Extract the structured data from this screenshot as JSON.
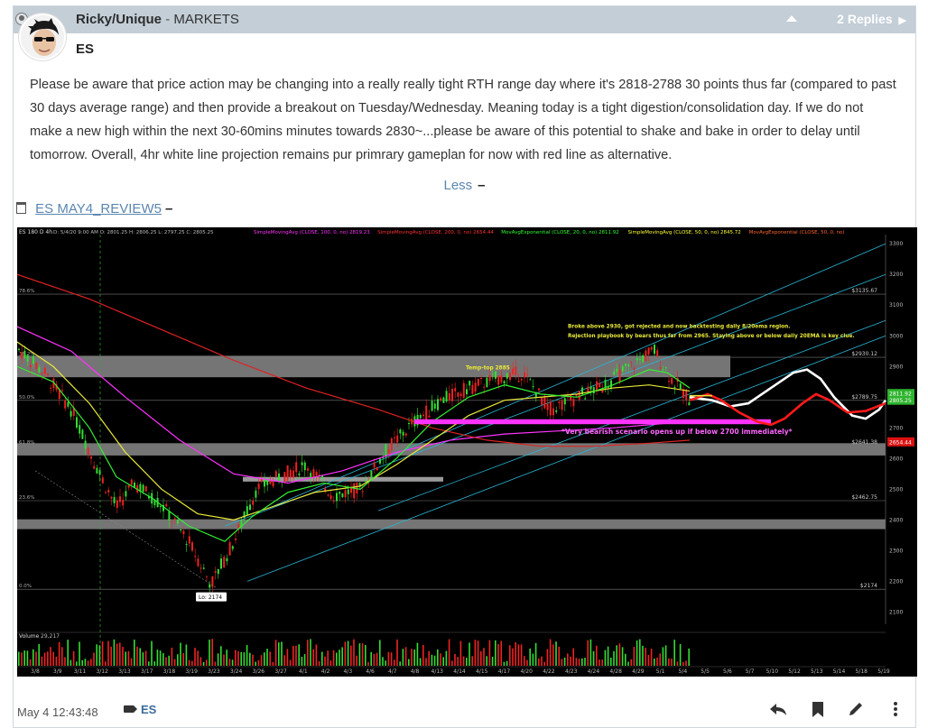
{
  "post": {
    "author": "Ricky/Unique",
    "separator": " - ",
    "category": "MARKETS",
    "replies": "2 Replies",
    "title": "ES",
    "body": "Please be aware that price action may be changing into a really really tight RTH range day where it's 2818-2788 30 points thus far (compared to past 30 days average range) and then provide a breakout on Tuesday/Wednesday. Meaning today is a tight digestion/consolidation day. If we do not make a new high within the next 30-60mins minutes towards 2830~...please be aware of this potential to shake and bake in order to delay until tomorrow. Overall, 4hr white line projection remains pur primrary gameplan for now with red line as alternative.",
    "less_label": "Less",
    "attachment_name": "ES MAY4_REVIEW5",
    "timestamp": "May 4 12:43:48",
    "tag": "ES"
  },
  "chart_data": {
    "type": "line",
    "symbol_header": "ES 180 D 4h",
    "ohlc": "D: 5/4/20 9:00 AM  O: 2801.25  H: 2806.25  L: 2797.25  C: 2805.25",
    "indicators": [
      {
        "name": "SimpleMovingAvg (CLOSE, 100, 0, no)",
        "value": "2819.23",
        "color": "#ff33ff"
      },
      {
        "name": "SimpleMovingAvg (CLOSE, 200, 0, no)",
        "value": "2654.44",
        "color": "#ff3333"
      },
      {
        "name": "MovAvgExponential (CLOSE, 20, 0, no)",
        "value": "2811.92",
        "color": "#33ff33"
      },
      {
        "name": "SimpleMovingAvg (CLOSE, 50, 0, no)",
        "value": "2845.72",
        "color": "#ffff33"
      },
      {
        "name": "MovAvgExponential (CLOSE, 50, 0, no)",
        "value": "",
        "color": "#ff6633"
      }
    ],
    "y_ticks": [
      3300,
      3200,
      3100,
      3000,
      2900,
      2800,
      2700,
      2600,
      2500,
      2400,
      2300,
      2200,
      2100
    ],
    "ylim": [
      2060,
      3330
    ],
    "x_ticks": [
      "3/8",
      "3/9",
      "3/11",
      "3/12",
      "3/13",
      "3/17",
      "3/18",
      "3/19",
      "3/23",
      "3/24",
      "3/26",
      "3/27",
      "4/1",
      "4/2",
      "4/3",
      "4/6",
      "4/7",
      "4/8",
      "4/13",
      "4/14",
      "4/15",
      "4/17",
      "4/20",
      "4/22",
      "4/23",
      "4/24",
      "4/28",
      "4/29",
      "5/1",
      "5/4",
      "5/5",
      "5/6",
      "5/7",
      "5/10",
      "5/12",
      "5/13",
      "5/14",
      "5/18",
      "5/19"
    ],
    "levels": [
      {
        "label": "$3135.67",
        "value": 3135.67
      },
      {
        "label": "$2930.12",
        "value": 2930.12
      },
      {
        "label": "$2789.75",
        "value": 2789.75
      },
      {
        "label": "$2641.38",
        "value": 2641.38
      },
      {
        "label": "$2462.75",
        "value": 2462.75
      },
      {
        "label": "$2174",
        "value": 2174
      }
    ],
    "fib_labels": [
      {
        "label": "78.6%",
        "value": 3135.67
      },
      {
        "label": "38.2%",
        "value": 2930.12
      },
      {
        "label": "50.0%",
        "value": 2789.75
      },
      {
        "label": "61.8%",
        "value": 2641.38
      },
      {
        "label": "23.6%",
        "value": 2462.75
      },
      {
        "label": "0.0%",
        "value": 2174
      }
    ],
    "price_tags": [
      {
        "label": "2811.92",
        "value": 2811.92,
        "color": "#2db32d"
      },
      {
        "label": "2805.25",
        "value": 2790,
        "color": "#2db32d"
      },
      {
        "label": "2654.44",
        "value": 2654.44,
        "color": "#d11"
      }
    ],
    "annotations": {
      "top_note_1": "Broke above 2930, got rejected and now backtesting daily 8/20ema region.",
      "top_note_2": "Rejection playbook by bears thus far from 2965. Staying above or below daily 20EMA is key clue.",
      "temp_top": "Temp-top 2885",
      "bearish": "*Very bearish scenario opens up if below 2700 immediately*",
      "low_label": "Lo: 2174",
      "volume_label": "Volume",
      "volume_value": "29,217"
    },
    "colors": {
      "white_projection": "#ffffff",
      "red_alternative": "#ff1a1a",
      "magenta_zone": "#ff33ff",
      "gray_zone": "#8a8a8a"
    }
  }
}
